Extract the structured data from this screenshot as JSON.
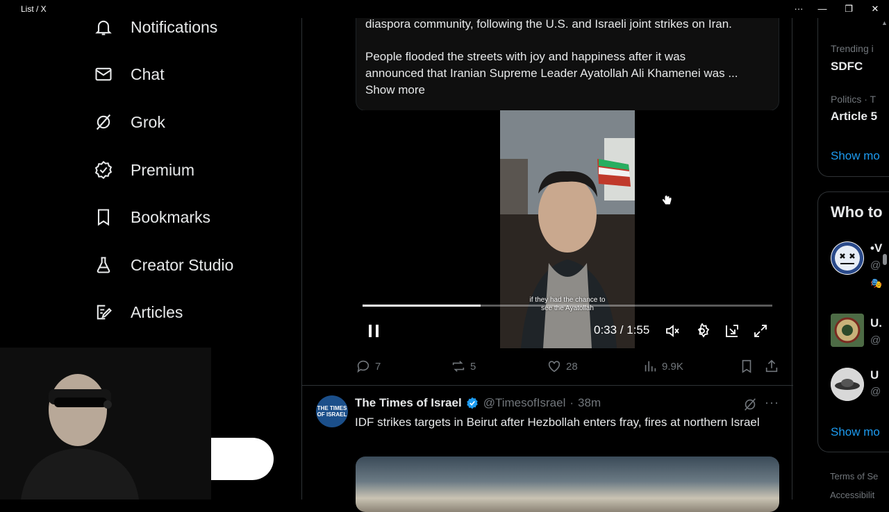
{
  "window": {
    "title": "List / X"
  },
  "nav": {
    "items": [
      {
        "label": "Notifications",
        "icon": "bell-icon"
      },
      {
        "label": "Chat",
        "icon": "envelope-icon"
      },
      {
        "label": "Grok",
        "icon": "grok-icon"
      },
      {
        "label": "Premium",
        "icon": "verified-badge-icon"
      },
      {
        "label": "Bookmarks",
        "icon": "bookmark-icon"
      },
      {
        "label": "Creator Studio",
        "icon": "flask-icon"
      },
      {
        "label": "Articles",
        "icon": "article-edit-icon"
      }
    ]
  },
  "post1": {
    "line1": "diaspora community, following the U.S. and Israeli joint strikes on Iran.",
    "line2": "People flooded the streets with joy and happiness after it was",
    "line3": "announced that Iranian Supreme Leader Ayatollah Ali Khamenei was ...",
    "show_more": "Show more",
    "video": {
      "caption_line1": "if they had the chance to",
      "caption_line2": "see the Ayatollah",
      "time": "0:33 / 1:55",
      "progress": 0.288
    },
    "actions": {
      "replies": "7",
      "reposts": "5",
      "likes": "28",
      "views": "9.9K"
    }
  },
  "post2": {
    "avatar_text_1": "THE TIMES",
    "avatar_text_2": "OF ISRAEL",
    "name": "The Times of Israel",
    "handle": "@TimesofIsrael",
    "separator": "·",
    "time": "38m",
    "text": "IDF strikes targets in Beirut after Hezbollah enters fray, fires at northern Israel"
  },
  "right": {
    "trending_label_1": "Trending i",
    "trending_title_1": "SDFC",
    "trending_label_2": "Politics · T",
    "trending_title_2": "Article 5",
    "show_more_1": "Show mo",
    "who_to_follow": "Who to",
    "follow_1_name": "•V",
    "follow_1_handle": "@",
    "follow_2_name": "U.",
    "follow_2_handle": "@",
    "follow_3_name": "U",
    "follow_3_handle": "@",
    "show_more_2": "Show mo",
    "terms": "Terms of Se",
    "accessibility": "Accessibilit"
  },
  "colors": {
    "accent": "#1d9bf0",
    "muted": "#71767b",
    "border": "#2f3336"
  }
}
